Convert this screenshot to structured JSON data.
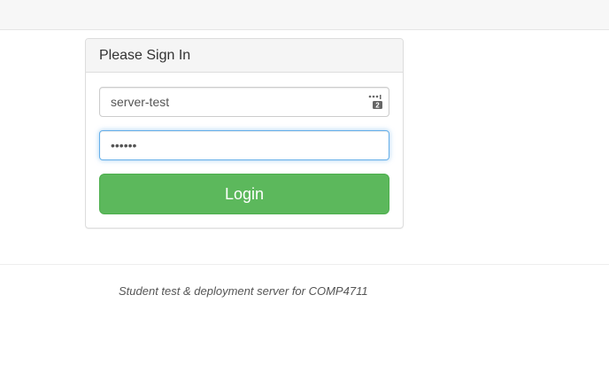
{
  "login_panel": {
    "title": "Please Sign In",
    "username": {
      "value": "server-test",
      "icon": "password-manager-icon"
    },
    "password": {
      "value": "••••••"
    },
    "login_button": "Login"
  },
  "footer": {
    "text": "Student test & deployment server for COMP4711"
  },
  "colors": {
    "button_green": "#5cb85c",
    "focus_blue": "#66afe9"
  }
}
